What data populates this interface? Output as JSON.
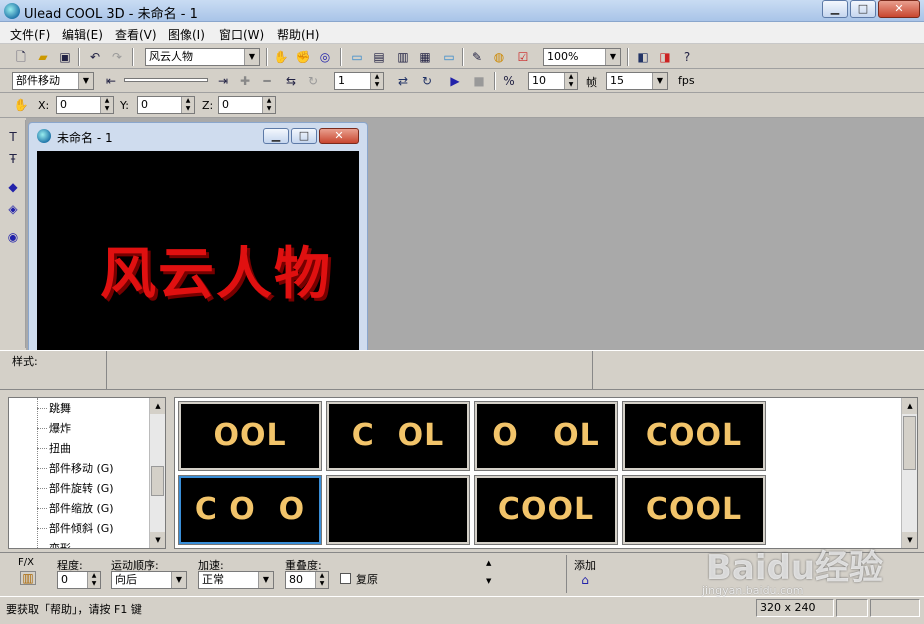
{
  "window": {
    "title": "Ulead COOL 3D - 未命名 - 1"
  },
  "menu": [
    "文件(F)",
    "编辑(E)",
    "查看(V)",
    "图像(I)",
    "窗口(W)",
    "帮助(H)"
  ],
  "toolbar1": {
    "text_object": "风云人物",
    "zoom": "100%"
  },
  "toolbar2": {
    "mode": "部件移动",
    "frame": "1",
    "frame_count": "10",
    "frame_label": "帧",
    "fps_value": "15",
    "fps_label": "fps"
  },
  "toolbar3": {
    "x_label": "X:",
    "x": "0",
    "y_label": "Y:",
    "y": "0",
    "z_label": "Z:",
    "z": "0"
  },
  "child_window": {
    "title": "未命名 - 1",
    "canvas_text": "风云人物"
  },
  "style_bar": {
    "label": "样式:"
  },
  "effects_tree": [
    "跳舞",
    "爆炸",
    "扭曲",
    "部件移动 (G)",
    "部件旋转 (G)",
    "部件缩放 (G)",
    "部件倾斜 (G)",
    "变形"
  ],
  "thumbnails": [
    {
      "text": "OOL"
    },
    {
      "text": "C  OL"
    },
    {
      "text": "O   OL"
    },
    {
      "text": "COOL"
    },
    {
      "text": "C O  O"
    },
    {
      "text": ""
    },
    {
      "text": "COOL"
    },
    {
      "text": "COOL"
    }
  ],
  "attributes": {
    "fx_label": "F/X",
    "degree_label": "程度:",
    "degree_value": "0",
    "order_label": "运动顺序:",
    "order_value": "向后",
    "accel_label": "加速:",
    "accel_value": "正常",
    "overlap_label": "重叠度:",
    "overlap_value": "80",
    "restore_label": "复原",
    "add_label": "添加"
  },
  "status": {
    "help": "要获取「帮助」，请按 F1 键",
    "size": "320 x 240"
  },
  "watermark": {
    "text": "Baidu经验",
    "url": "jingyan.baidu.com"
  }
}
